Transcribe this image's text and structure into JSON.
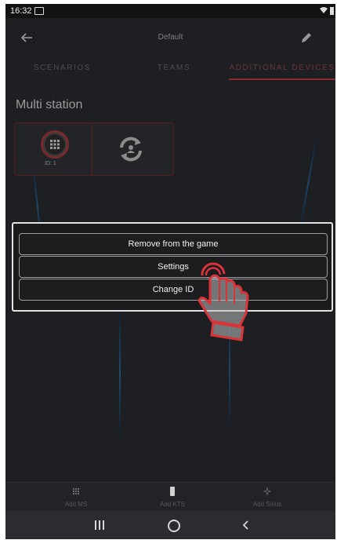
{
  "status_bar": {
    "time": "16:32"
  },
  "app_bar": {
    "title": "Default"
  },
  "tabs": [
    {
      "label": "SCENARIOS"
    },
    {
      "label": "TEAMS"
    },
    {
      "label": "ADDITIONAL DEVICES",
      "active": true
    }
  ],
  "section": {
    "title": "Multi station"
  },
  "device_card": {
    "id_label": "ID: 1"
  },
  "dialog": {
    "buttons": [
      {
        "label": "Remove from the game"
      },
      {
        "label": "Settings"
      },
      {
        "label": "Change ID"
      }
    ]
  },
  "bottom_bar": {
    "items": [
      {
        "label": "Add MS",
        "icon": "ms-grid-icon"
      },
      {
        "label": "Add KTS",
        "icon": "kts-device-icon"
      },
      {
        "label": "Add Sirius",
        "icon": "sirius-star-icon"
      }
    ]
  },
  "colors": {
    "accent_red": "#8b2b2e",
    "background": "#1d1f22",
    "dialog_border": "#e3e3e3",
    "hand_outline": "#d8343a"
  }
}
